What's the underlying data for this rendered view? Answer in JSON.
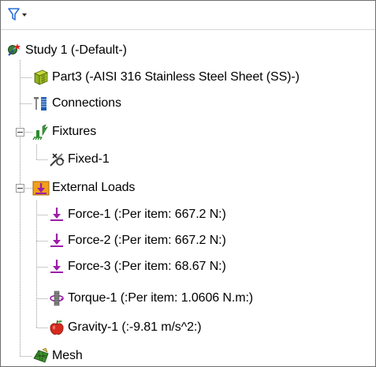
{
  "toolbar": {
    "filter_icon": "funnel-filter-icon",
    "dropdown_icon": "dropdown-arrow-icon"
  },
  "tree": {
    "study": {
      "label": "Study 1 (-Default-)",
      "icon": "study-icon"
    },
    "part": {
      "label": "Part3 (-AISI 316 Stainless Steel Sheet (SS)-)",
      "icon": "sheet-metal-part-icon"
    },
    "connections": {
      "label": "Connections",
      "icon": "connections-icon"
    },
    "fixtures": {
      "label": "Fixtures",
      "icon": "fixtures-icon",
      "expanded": true,
      "items": [
        {
          "label": "Fixed-1",
          "icon": "fixed-geometry-icon"
        }
      ]
    },
    "external_loads": {
      "label": "External Loads",
      "icon": "external-loads-icon",
      "expanded": true,
      "items": [
        {
          "label": "Force-1 (:Per item: 667.2 N:)",
          "icon": "force-arrow-icon"
        },
        {
          "label": "Force-2 (:Per item: 667.2 N:)",
          "icon": "force-arrow-icon"
        },
        {
          "label": "Force-3 (:Per item: 68.67 N:)",
          "icon": "force-arrow-icon"
        },
        {
          "label": "Torque-1 (:Per item: 1.0606 N.m:)",
          "icon": "torque-icon"
        },
        {
          "label": "Gravity-1 (:-9.81 m/s^2:)",
          "icon": "gravity-apple-icon"
        }
      ]
    },
    "mesh": {
      "label": "Mesh",
      "icon": "mesh-icon"
    }
  },
  "colors": {
    "force_arrow": "#9b1ea8",
    "gravity_apple": "#d52b1e",
    "connections_blue": "#1f5cb3",
    "fixtures_green": "#2e8b2e",
    "external_loads_orange": "#f2a01a",
    "guide_line": "#9a9a9a"
  }
}
